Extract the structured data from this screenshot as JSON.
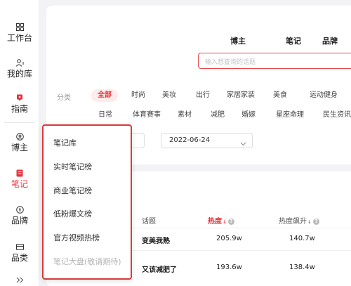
{
  "sidebar": {
    "items": [
      {
        "label": "工作台",
        "icon": "grid-icon"
      },
      {
        "label": "我的库",
        "icon": "user-library-icon"
      },
      {
        "label": "指南",
        "icon": "guide-icon"
      },
      {
        "label": "博主",
        "icon": "blogger-icon"
      },
      {
        "label": "笔记",
        "icon": "notebook-icon"
      },
      {
        "label": "品牌",
        "icon": "brand-icon"
      },
      {
        "label": "品类",
        "icon": "category-icon"
      }
    ],
    "active_index": 4,
    "collapse_icon": "double-chevron-right-icon"
  },
  "top_tabs": [
    "博主",
    "笔记",
    "品牌"
  ],
  "search": {
    "placeholder": "输入想查询的话题"
  },
  "category": {
    "label": "分类",
    "row1": [
      "全部",
      "时尚",
      "美妆",
      "出行",
      "家居家装",
      "美食",
      "运动健身"
    ],
    "row2": [
      "日常",
      "体育赛事",
      "素材",
      "减肥",
      "婚嫁",
      "星座命理",
      "民生资讯"
    ],
    "active": "全部"
  },
  "filters": {
    "date": "2022-06-24"
  },
  "table": {
    "headers": {
      "topic": "话题",
      "heat": "热度",
      "heat_rise": "热度飙升"
    },
    "rows": [
      {
        "topic": "变美我熟",
        "heat": "205.9w",
        "heat_rise": "140.7w"
      },
      {
        "topic": "又该减肥了",
        "heat": "193.6w",
        "heat_rise": "138.4w"
      }
    ]
  },
  "menu": {
    "items": [
      {
        "label": "笔记库",
        "disabled": false
      },
      {
        "label": "实时笔记榜",
        "disabled": false
      },
      {
        "label": "商业笔记榜",
        "disabled": false
      },
      {
        "label": "低粉爆文榜",
        "disabled": false
      },
      {
        "label": "官方视频热榜",
        "disabled": false
      },
      {
        "label": "笔记大盘(敬请期待)",
        "disabled": true
      }
    ]
  },
  "colors": {
    "accent": "#e8323b",
    "menu_border": "#d93a3a"
  }
}
